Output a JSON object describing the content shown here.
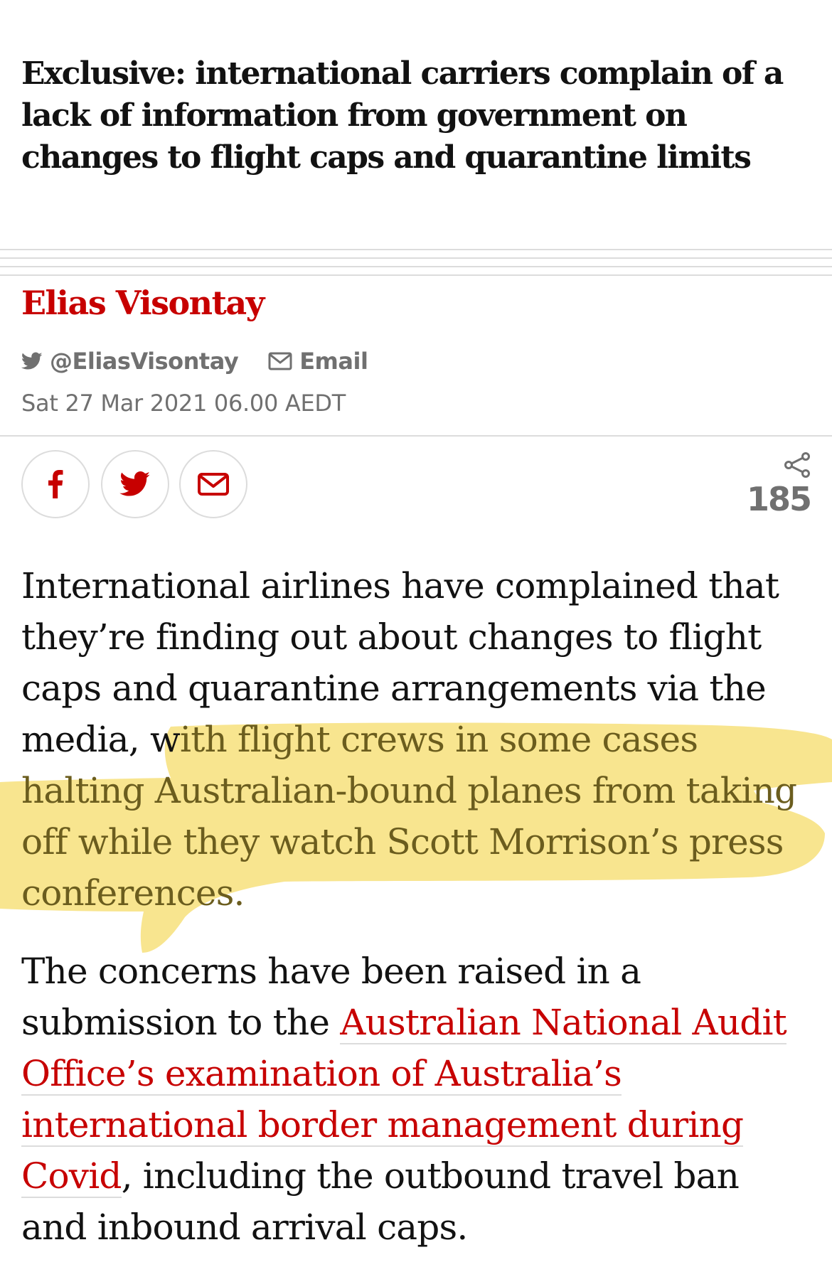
{
  "article": {
    "standfirst": "Exclusive: international carriers complain of a lack of information from government on changes to flight caps and quarantine limits",
    "byline": {
      "name": "Elias Visontay",
      "twitter_handle": "@EliasVisontay",
      "email_label": "Email",
      "date": "Sat 27 Mar 2021 06.00 AEDT"
    },
    "share": {
      "buttons": [
        {
          "icon": "facebook-icon"
        },
        {
          "icon": "twitter-icon"
        },
        {
          "icon": "email-icon"
        }
      ],
      "share_icon": "share-icon",
      "count": "185"
    },
    "paragraphs": {
      "p1_before": "International airlines have complained that they’re finding out about changes to flight caps and quarantine arrangements via the media, w",
      "p1_highlight": "ith flight crews in some cases halting Australian-bound planes from taking off while they watch Scott Morrison’s press conferences.",
      "p2_before": "The concerns have been raised in a submission to the ",
      "p2_link": "Australian National Audit Office’s examination of Australia’s international border management during Covid",
      "p2_after": ", including the outbound travel ban and inbound arrival caps."
    }
  },
  "colors": {
    "accent": "#c70000",
    "highlight": "#f5dc6a",
    "meta_gray": "#707070",
    "rule": "#dcdcdc"
  }
}
